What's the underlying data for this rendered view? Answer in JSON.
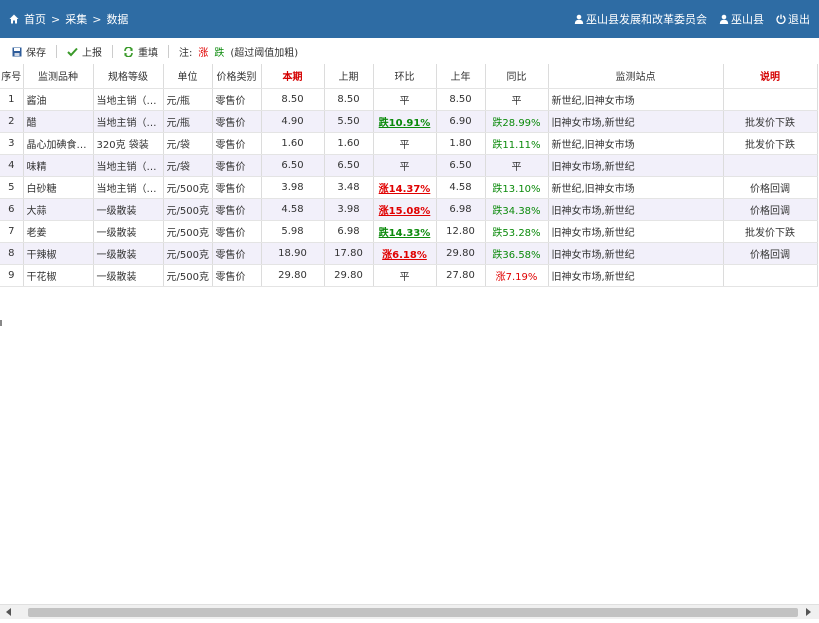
{
  "breadcrumb": {
    "home": "首页",
    "sep": ">",
    "collect": "采集",
    "data": "数据"
  },
  "header_right": {
    "org": "巫山县发展和改革委员会",
    "county": "巫山县",
    "logout": "退出"
  },
  "toolbar": {
    "save": "保存",
    "report": "上报",
    "refill": "重填",
    "note_prefix": "注:",
    "rise_label": "涨",
    "fall_label": "跌",
    "note_hint": "(超过阈值加粗)"
  },
  "columns": {
    "seq": "序号",
    "item": "监测品种",
    "spec": "规格等级",
    "unit": "单位",
    "ptype": "价格类别",
    "cur": "本期",
    "prev": "上期",
    "mom": "环比",
    "lastyear": "上年",
    "yoy": "同比",
    "sites": "监测站点",
    "note": "说明"
  },
  "rows": [
    {
      "seq": "1",
      "item": "酱油",
      "spec": "当地主销（…",
      "unit": "元/瓶",
      "ptype": "零售价",
      "cur": "8.50",
      "prev": "8.50",
      "mom": "平",
      "mom_dir": "flat",
      "mom_bold": false,
      "ly": "8.50",
      "yoy": "平",
      "yoy_dir": "flat",
      "sites": "新世纪,旧神女市场",
      "note": ""
    },
    {
      "seq": "2",
      "item": "醋",
      "spec": "当地主销（…",
      "unit": "元/瓶",
      "ptype": "零售价",
      "cur": "4.90",
      "prev": "5.50",
      "mom": "跌10.91%",
      "mom_dir": "fall",
      "mom_bold": true,
      "ly": "6.90",
      "yoy": "跌28.99%",
      "yoy_dir": "fall",
      "sites": "旧神女市场,新世纪",
      "note": "批发价下跌"
    },
    {
      "seq": "3",
      "item": "晶心加碘食…",
      "spec": "320克 袋装",
      "unit": "元/袋",
      "ptype": "零售价",
      "cur": "1.60",
      "prev": "1.60",
      "mom": "平",
      "mom_dir": "flat",
      "mom_bold": false,
      "ly": "1.80",
      "yoy": "跌11.11%",
      "yoy_dir": "fall",
      "sites": "新世纪,旧神女市场",
      "note": "批发价下跌"
    },
    {
      "seq": "4",
      "item": "味精",
      "spec": "当地主销（…",
      "unit": "元/袋",
      "ptype": "零售价",
      "cur": "6.50",
      "prev": "6.50",
      "mom": "平",
      "mom_dir": "flat",
      "mom_bold": false,
      "ly": "6.50",
      "yoy": "平",
      "yoy_dir": "flat",
      "sites": "旧神女市场,新世纪",
      "note": ""
    },
    {
      "seq": "5",
      "item": "白砂糖",
      "spec": "当地主销（…",
      "unit": "元/500克",
      "ptype": "零售价",
      "cur": "3.98",
      "prev": "3.48",
      "mom": "涨14.37%",
      "mom_dir": "rise",
      "mom_bold": true,
      "ly": "4.58",
      "yoy": "跌13.10%",
      "yoy_dir": "fall",
      "sites": "新世纪,旧神女市场",
      "note": "价格回调"
    },
    {
      "seq": "6",
      "item": "大蒜",
      "spec": "一级散装",
      "unit": "元/500克",
      "ptype": "零售价",
      "cur": "4.58",
      "prev": "3.98",
      "mom": "涨15.08%",
      "mom_dir": "rise",
      "mom_bold": true,
      "ly": "6.98",
      "yoy": "跌34.38%",
      "yoy_dir": "fall",
      "sites": "旧神女市场,新世纪",
      "note": "价格回调"
    },
    {
      "seq": "7",
      "item": "老姜",
      "spec": "一级散装",
      "unit": "元/500克",
      "ptype": "零售价",
      "cur": "5.98",
      "prev": "6.98",
      "mom": "跌14.33%",
      "mom_dir": "fall",
      "mom_bold": true,
      "ly": "12.80",
      "yoy": "跌53.28%",
      "yoy_dir": "fall",
      "sites": "旧神女市场,新世纪",
      "note": "批发价下跌"
    },
    {
      "seq": "8",
      "item": "干辣椒",
      "spec": "一级散装",
      "unit": "元/500克",
      "ptype": "零售价",
      "cur": "18.90",
      "prev": "17.80",
      "mom": "涨6.18%",
      "mom_dir": "rise",
      "mom_bold": true,
      "ly": "29.80",
      "yoy": "跌36.58%",
      "yoy_dir": "fall",
      "sites": "旧神女市场,新世纪",
      "note": "价格回调"
    },
    {
      "seq": "9",
      "item": "干花椒",
      "spec": "一级散装",
      "unit": "元/500克",
      "ptype": "零售价",
      "cur": "29.80",
      "prev": "29.80",
      "mom": "平",
      "mom_dir": "flat",
      "mom_bold": false,
      "ly": "27.80",
      "yoy": "涨7.19%",
      "yoy_dir": "rise",
      "sites": "旧神女市场,新世纪",
      "note": ""
    }
  ],
  "colors": {
    "header_bg": "#2e6ca4",
    "rise": "#e00000",
    "fall": "#0b8a0b",
    "alt_row": "#f2f0fa"
  }
}
